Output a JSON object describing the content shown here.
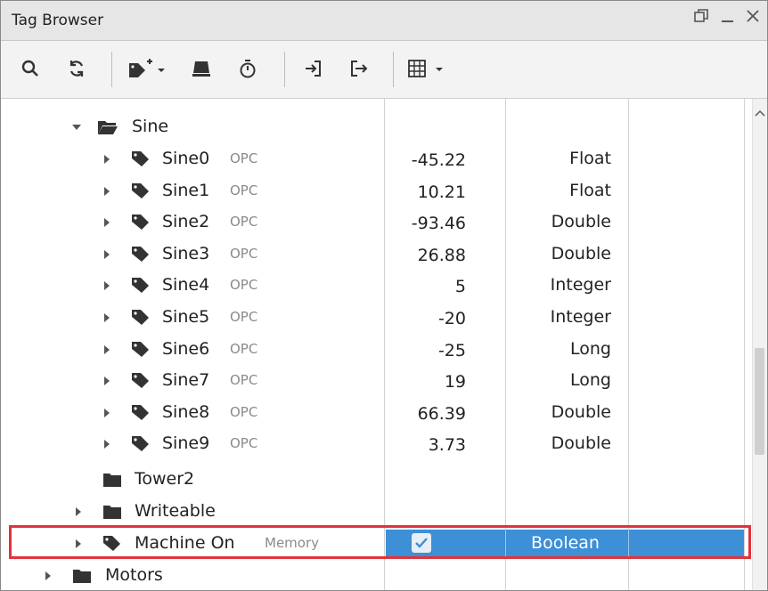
{
  "window": {
    "title": "Tag Browser"
  },
  "toolbar": {
    "buttons": [
      "search-icon",
      "refresh-icon",
      "add-tag-icon",
      "edit-tag-icon",
      "timer-icon",
      "import-icon",
      "export-icon",
      "table-view-icon"
    ]
  },
  "tree": {
    "folder_sine": {
      "label": "Sine"
    },
    "tags": [
      {
        "name": "Sine0",
        "provider": "OPC",
        "value": "-45.22",
        "type": "Float"
      },
      {
        "name": "Sine1",
        "provider": "OPC",
        "value": "10.21",
        "type": "Float"
      },
      {
        "name": "Sine2",
        "provider": "OPC",
        "value": "-93.46",
        "type": "Double"
      },
      {
        "name": "Sine3",
        "provider": "OPC",
        "value": "26.88",
        "type": "Double"
      },
      {
        "name": "Sine4",
        "provider": "OPC",
        "value": "5",
        "type": "Integer"
      },
      {
        "name": "Sine5",
        "provider": "OPC",
        "value": "-20",
        "type": "Integer"
      },
      {
        "name": "Sine6",
        "provider": "OPC",
        "value": "-25",
        "type": "Long"
      },
      {
        "name": "Sine7",
        "provider": "OPC",
        "value": "19",
        "type": "Long"
      },
      {
        "name": "Sine8",
        "provider": "OPC",
        "value": "66.39",
        "type": "Double"
      },
      {
        "name": "Sine9",
        "provider": "OPC",
        "value": "3.73",
        "type": "Double"
      }
    ],
    "folder_tower2": {
      "label": "Tower2"
    },
    "folder_writeable": {
      "label": "Writeable"
    },
    "selected_tag": {
      "name": "Machine On",
      "provider": "Memory",
      "value": true,
      "type": "Boolean"
    },
    "folder_motors": {
      "label": "Motors"
    }
  },
  "colors": {
    "selection": "#3d8fd6",
    "highlight_border": "#e0343b"
  }
}
